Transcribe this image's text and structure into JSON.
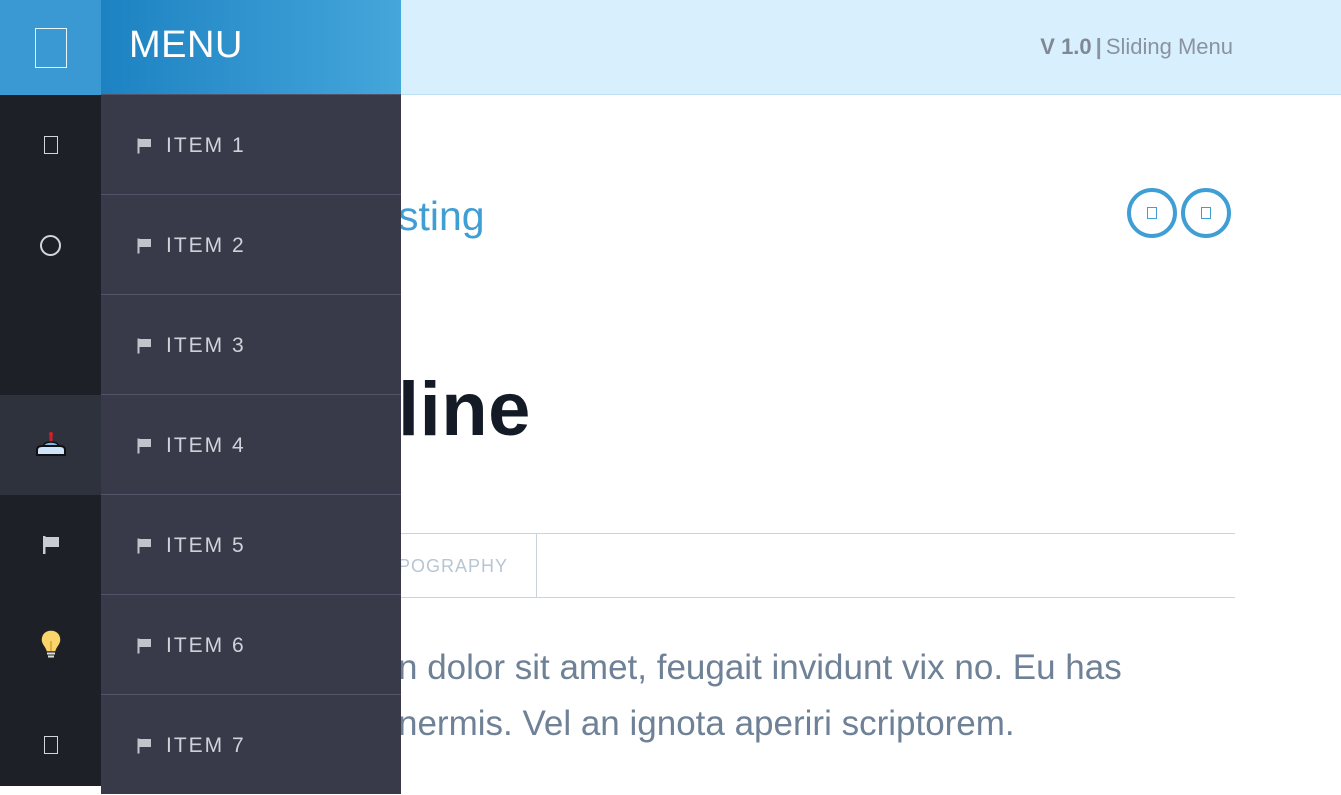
{
  "header": {
    "version": "V 1.0",
    "separator": "|",
    "app_name": "Sliding Menu"
  },
  "menu": {
    "title": "MENU",
    "items": [
      {
        "label": "ITEM 1"
      },
      {
        "label": "ITEM 2"
      },
      {
        "label": "ITEM 3"
      },
      {
        "label": "ITEM 4"
      },
      {
        "label": "ITEM 5"
      },
      {
        "label": "ITEM 6"
      },
      {
        "label": "ITEM 7"
      }
    ]
  },
  "rail": {
    "icons": [
      "menu-box-icon",
      "square-icon",
      "circle-icon",
      "blank-icon",
      "joystick-icon",
      "flag-icon",
      "lightbulb-icon",
      "square-icon"
    ],
    "active_index": 4
  },
  "content": {
    "post_link_fragment": "sting",
    "headline_fragment": "line",
    "tab_fragment": "POGRAPHY",
    "body_line1": "n dolor sit amet, feugait invidunt vix no. Eu has",
    "body_line2": "nermis. Vel an ignota aperiri scriptorem."
  },
  "colors": {
    "accent": "#3f9fd4",
    "header_bg": "#d8f0fd",
    "panel_bg": "#383a4a",
    "rail_bg": "#1d2027"
  }
}
